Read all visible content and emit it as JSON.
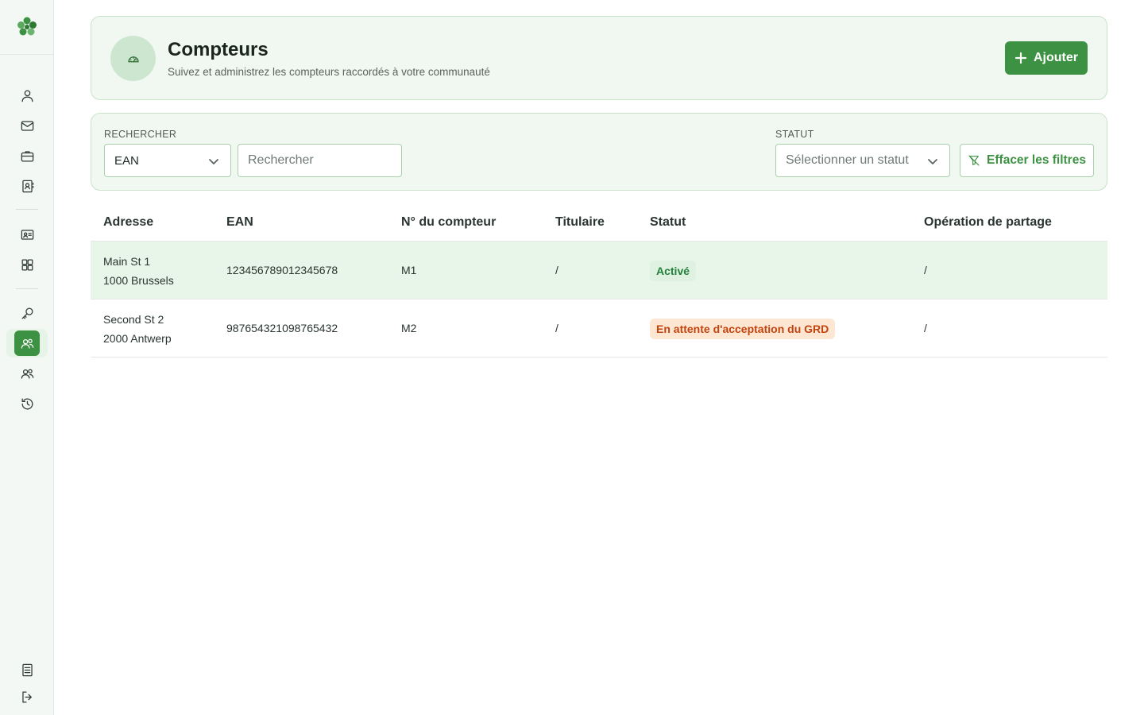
{
  "sidebar": {
    "brand_color": "#3d9142",
    "top_icons": [
      "user-icon",
      "mail-icon",
      "briefcase-icon",
      "contact-book-icon"
    ],
    "middle_icons": [
      "id-card-icon",
      "grid-icon"
    ],
    "bottom_group_icons": [
      "key-icon",
      "community-icon",
      "group-icon",
      "history-icon"
    ],
    "footer_icons": [
      "document-icon",
      "logout-icon"
    ],
    "active_item": "community-icon"
  },
  "header": {
    "title": "Compteurs",
    "subtitle": "Suivez et administrez les compteurs raccordés à votre communauté",
    "icon": "gauge-icon",
    "add_label": "Ajouter"
  },
  "filters": {
    "search_label": "RECHERCHER",
    "search_field_selected": "EAN",
    "search_placeholder": "Rechercher",
    "status_label": "STATUT",
    "status_placeholder": "Sélectionner un statut",
    "clear_label": "Effacer les filtres"
  },
  "table": {
    "columns": [
      "Adresse",
      "EAN",
      "N° du compteur",
      "Titulaire",
      "Statut",
      "Opération de partage"
    ],
    "rows": [
      {
        "address_line1": "Main St 1",
        "address_line2": "1000 Brussels",
        "ean": "123456789012345678",
        "meter_number": "M1",
        "holder": "/",
        "status": "Activé",
        "status_color": "green",
        "sharing_operation": "/"
      },
      {
        "address_line1": "Second St 2",
        "address_line2": "2000 Antwerp",
        "ean": "987654321098765432",
        "meter_number": "M2",
        "holder": "/",
        "status": "En attente d'acceptation du GRD",
        "status_color": "orange",
        "sharing_operation": "/"
      }
    ]
  }
}
